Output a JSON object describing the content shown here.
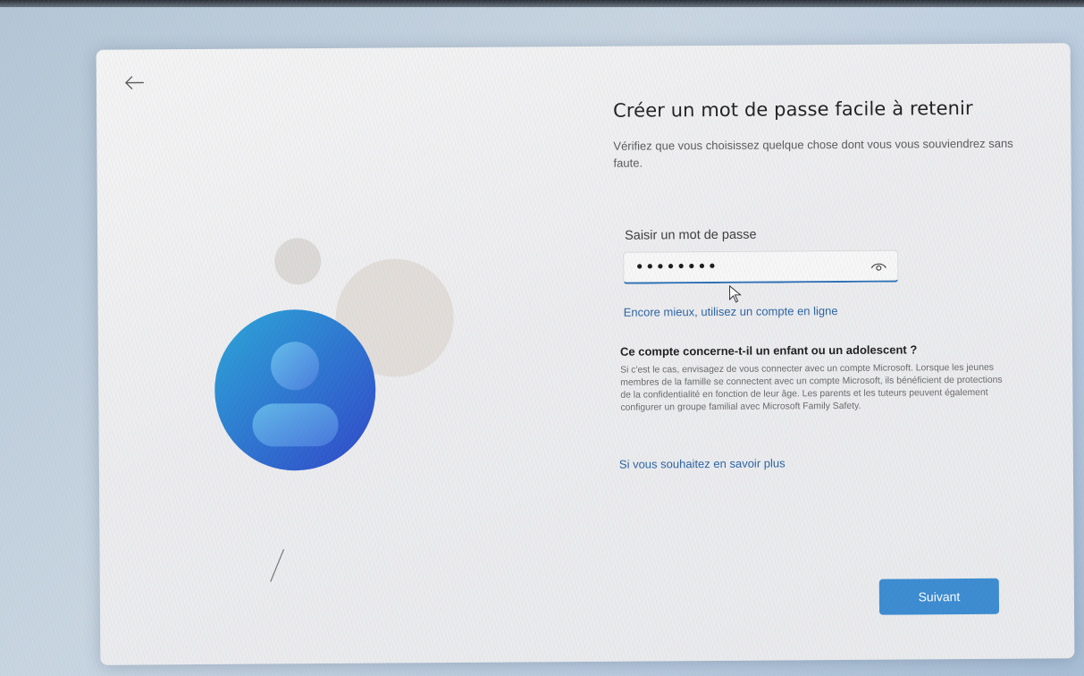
{
  "page": {
    "title": "Créer un mot de passe facile à retenir",
    "subtitle": "Vérifiez que vous choisissez quelque chose dont vous vous souviendrez sans faute."
  },
  "password_field": {
    "label": "Saisir un mot de passe",
    "value": "••••••••",
    "reveal_icon": "eye-icon"
  },
  "links": {
    "online_account": "Encore mieux, utilisez un compte en ligne",
    "learn_more": "Si vous souhaitez en savoir plus"
  },
  "child_section": {
    "title": "Ce compte concerne-t-il un enfant ou un adolescent ?",
    "body": "Si c'est le cas, envisagez de vous connecter avec un compte Microsoft. Lorsque les jeunes membres de la famille se connectent avec un compte Microsoft, ils bénéficient de protections de la confidentialité en fonction de leur âge. Les parents et les tuteurs peuvent également configurer un groupe familial avec Microsoft Family Safety."
  },
  "buttons": {
    "next": "Suivant"
  },
  "icons": {
    "back": "back-arrow-icon",
    "avatar": "user-avatar-icon",
    "pointer": "mouse-pointer-icon"
  },
  "colors": {
    "accent": "#3b8bd1",
    "link": "#2b63a3",
    "avatar_gradient_start": "#2aa7d8",
    "avatar_gradient_end": "#2f45c9"
  }
}
